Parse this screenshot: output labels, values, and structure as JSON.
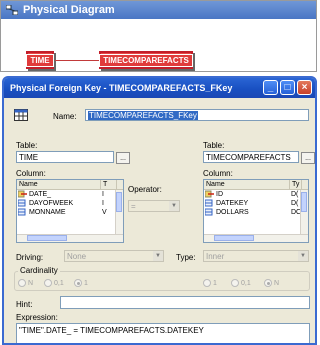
{
  "bg_window": {
    "title": "Physical Diagram"
  },
  "diagram": {
    "table_left": "TIME",
    "table_right": "TIMECOMPAREFACTS"
  },
  "dialog": {
    "title": "Physical Foreign Key - TIMECOMPAREFACTS_FKey",
    "name_label": "Name:",
    "name_value": "TIMECOMPAREFACTS_FKey",
    "left": {
      "table_label": "Table:",
      "table_value": "TIME",
      "browse": "...",
      "column_label": "Column:",
      "headers": [
        "Name",
        "T"
      ],
      "rows": [
        {
          "name": "DATE_",
          "type": "I"
        },
        {
          "name": "DAYOFWEEK",
          "type": "I"
        },
        {
          "name": "MONNAME",
          "type": "V"
        }
      ]
    },
    "operator_label": "Operator:",
    "operator_value": "=",
    "right": {
      "table_label": "Table:",
      "table_value": "TIMECOMPAREFACTS",
      "browse": "...",
      "column_label": "Column:",
      "headers": [
        "Name",
        "Ty"
      ],
      "rows": [
        {
          "name": "ID",
          "type": "D("
        },
        {
          "name": "DATEKEY",
          "type": "D("
        },
        {
          "name": "DOLLARS",
          "type": "DC"
        }
      ]
    },
    "driving_label": "Driving:",
    "driving_value": "None",
    "type_label": "Type:",
    "type_value": "Inner",
    "cardinality_label": "Cardinality",
    "card_left": [
      "N",
      "0,1",
      "1"
    ],
    "card_right": [
      "1",
      "0,1",
      "N"
    ],
    "hint_label": "Hint:",
    "expression_label": "Expression:",
    "expression_value": "\"TIME\".DATE_ = TIMECOMPAREFACTS.DATEKEY",
    "title_buttons": [
      "_",
      "□",
      "×"
    ]
  }
}
